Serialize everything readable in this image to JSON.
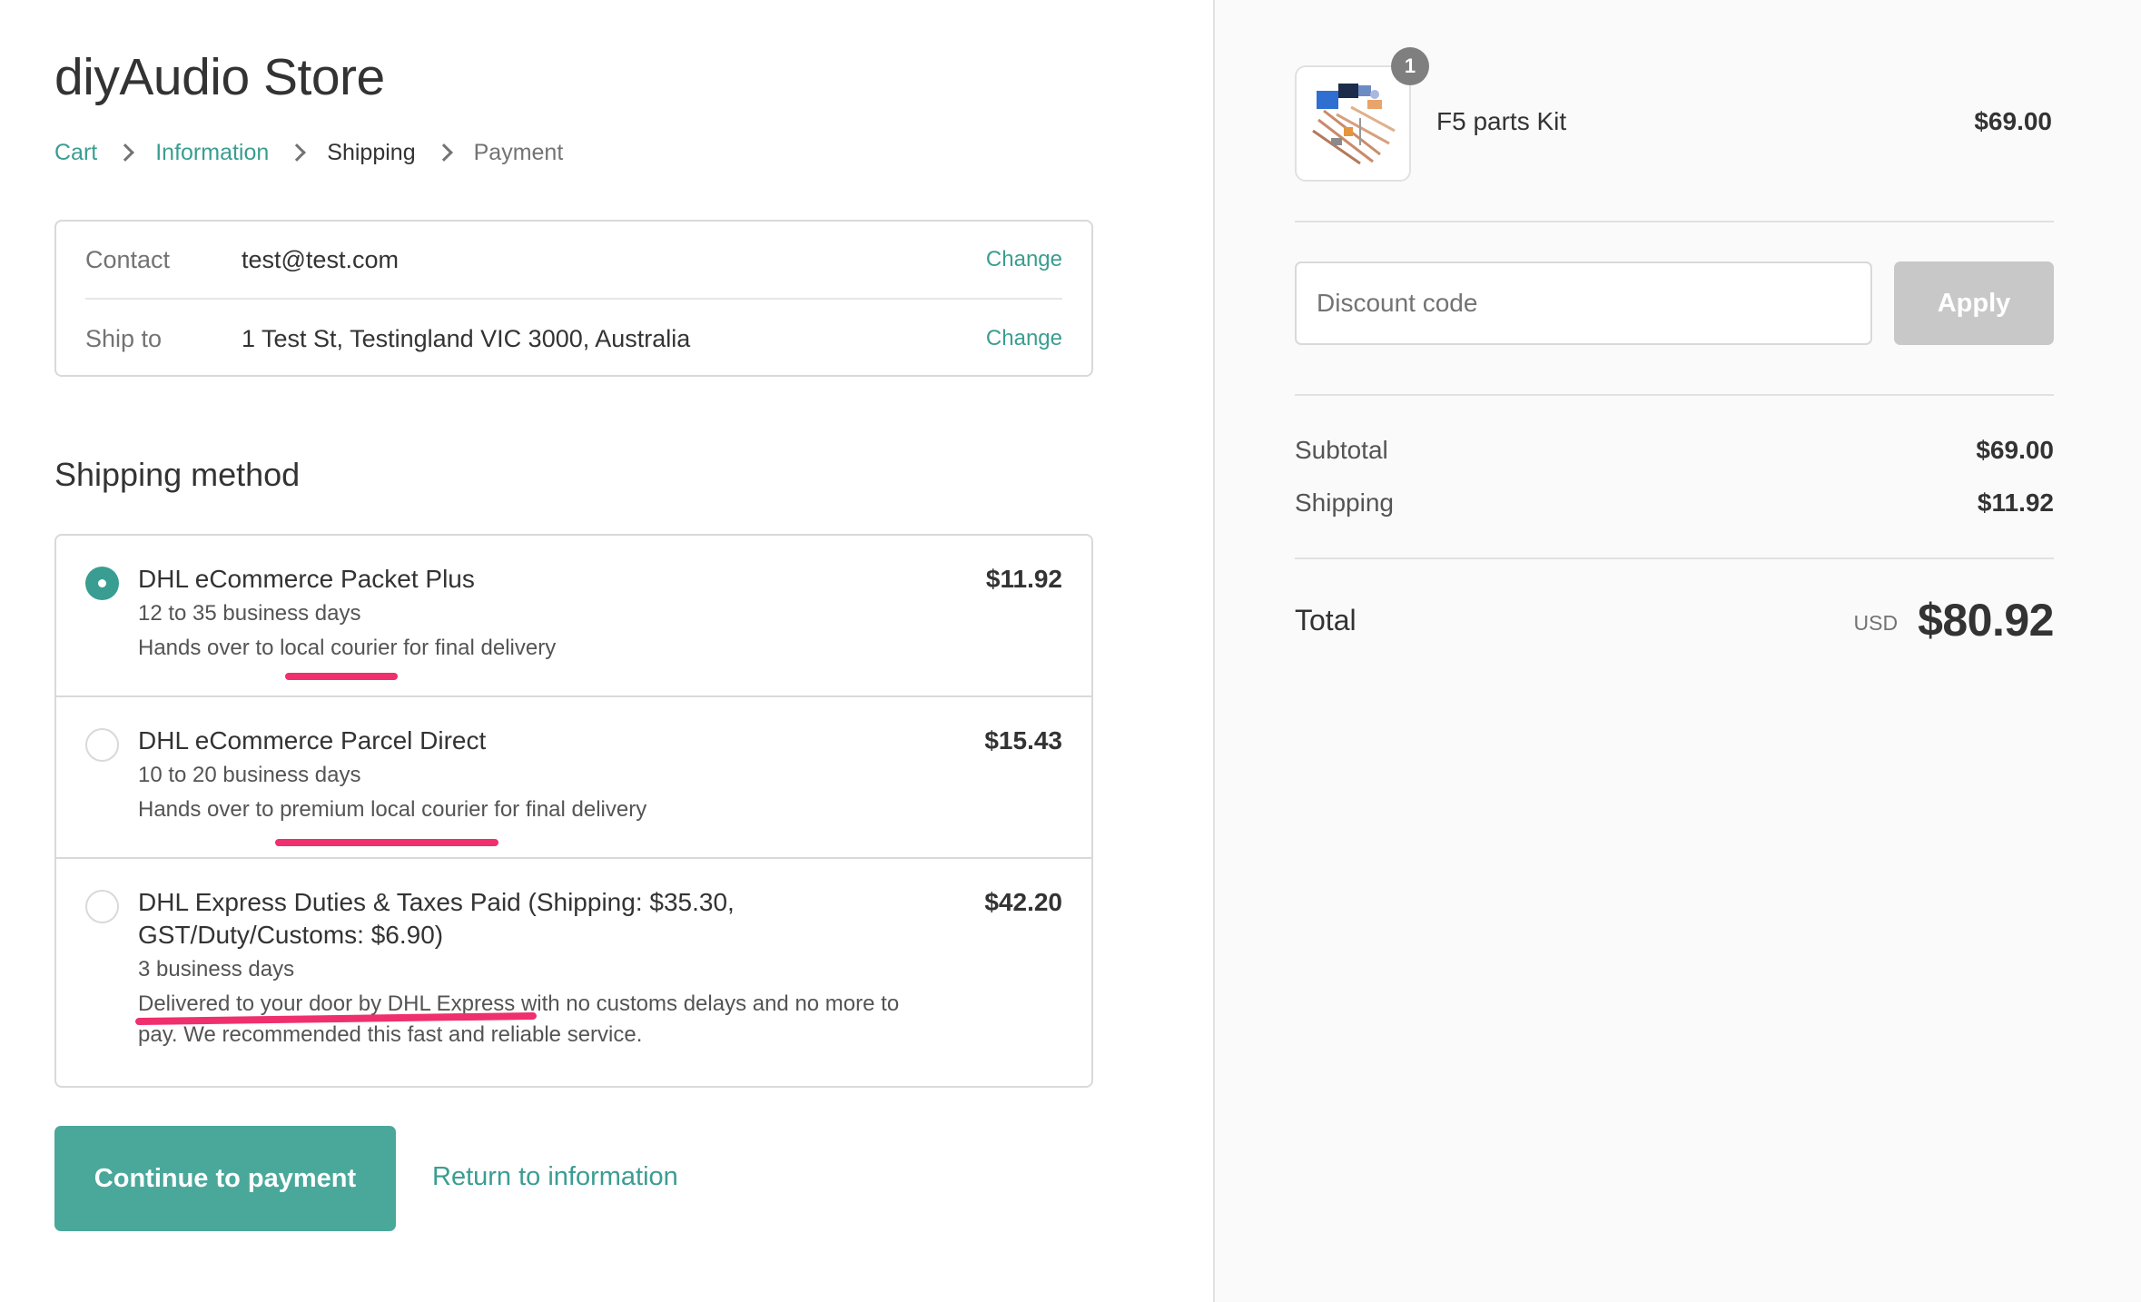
{
  "store": {
    "title": "diyAudio Store"
  },
  "breadcrumb": {
    "cart": "Cart",
    "information": "Information",
    "shipping": "Shipping",
    "payment": "Payment"
  },
  "review": {
    "contact_label": "Contact",
    "contact_value": "test@test.com",
    "ship_to_label": "Ship to",
    "ship_to_value": "1 Test St, Testingland VIC 3000, Australia",
    "change_label": "Change"
  },
  "shipping": {
    "heading": "Shipping method",
    "selected_index": 0,
    "methods": [
      {
        "name": "DHL eCommerce Packet Plus",
        "lines": [
          "12 to 35 business days",
          "Hands over to local courier for final delivery"
        ],
        "price": "$11.92"
      },
      {
        "name": "DHL eCommerce Parcel Direct",
        "lines": [
          "10 to 20 business days",
          "Hands over to premium local courier for final delivery"
        ],
        "price": "$15.43"
      },
      {
        "name": "DHL Express Duties & Taxes Paid (Shipping: $35.30,",
        "name_line2": "GST/Duty/Customs: $6.90)",
        "lines": [
          "3 business days",
          "Delivered to your door by DHL Express with no customs delays and no more to",
          "pay. We recommended this fast and reliable service."
        ],
        "price": "$42.20"
      }
    ]
  },
  "actions": {
    "continue_label": "Continue to payment",
    "return_label": "Return to information"
  },
  "annotation_color": "#ef2f6e",
  "accent_color": "#3a9d91",
  "summary": {
    "product": {
      "name": "F5 parts Kit",
      "price": "$69.00",
      "quantity": "1"
    },
    "discount": {
      "placeholder": "Discount code",
      "apply_label": "Apply"
    },
    "subtotal_label": "Subtotal",
    "subtotal_value": "$69.00",
    "shipping_label": "Shipping",
    "shipping_value": "$11.92",
    "total_label": "Total",
    "currency": "USD",
    "total_value": "$80.92"
  }
}
